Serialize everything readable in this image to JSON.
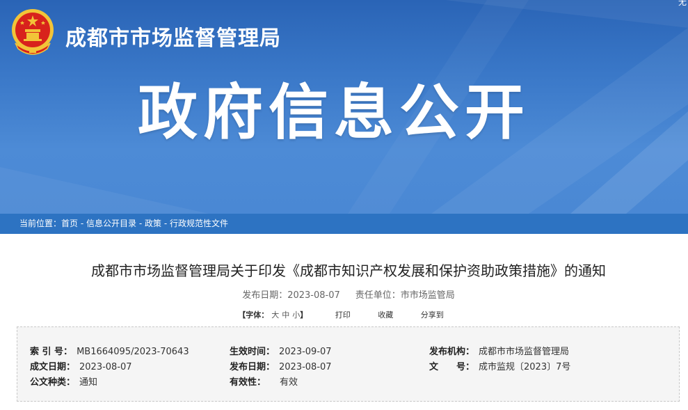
{
  "header": {
    "site_title": "成都市市场监督管理局",
    "banner_title": "政府信息公开",
    "corner_char": "无"
  },
  "breadcrumb": {
    "prefix": "当前位置：",
    "items": [
      "首页",
      "信息公开目录",
      "政策",
      "行政规范性文件"
    ],
    "separator": " - "
  },
  "article": {
    "title": "成都市市场监督管理局关于印发《成都市知识产权发展和保护资助政策措施》的通知",
    "publish_date_label": "发布日期：",
    "publish_date": "2023-08-07",
    "dept_label": "责任单位：",
    "dept": "市市场监管局"
  },
  "tools": {
    "font_label": "【字体：",
    "sizes": [
      "大",
      "中",
      "小"
    ],
    "font_close": "】",
    "print": "打印",
    "favorite": "收藏",
    "share": "分享到"
  },
  "info": {
    "index_label": "索 引 号：",
    "index_value": "MB1664095/2023-70643",
    "effective_label": "生效时间：",
    "effective_value": "2023-09-07",
    "issuer_label": "发布机构：",
    "issuer_value": "成都市市场监督管理局",
    "created_label": "成文日期：",
    "created_value": "2023-08-07",
    "published_label": "发布日期：",
    "published_value": "2023-08-07",
    "docno_label": "文　　号：",
    "docno_value": "成市监规〔2023〕7号",
    "type_label": "公文种类：",
    "type_value": "通知",
    "validity_label": "有效性：",
    "validity_value": "有效"
  },
  "colors": {
    "banner_blue": "#3a78c8",
    "breadcrumb_blue": "#2d73c2",
    "emblem_red": "#d8221c",
    "emblem_gold": "#f2c438"
  }
}
